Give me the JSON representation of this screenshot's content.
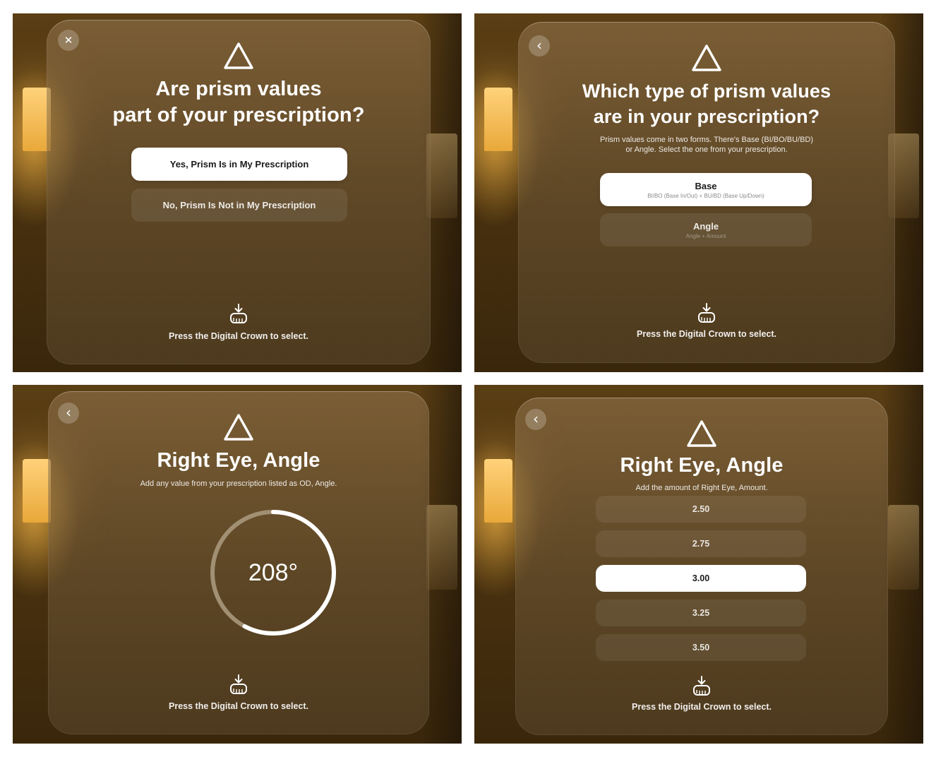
{
  "colors": {
    "glass": "#8a6e45",
    "selected_bg": "#ffffff",
    "selected_text": "#1a1a1a",
    "text": "#ffffff",
    "dial_progress": "#ffffff",
    "dial_track": "#a8987c"
  },
  "icons": {
    "close": "close-icon",
    "back": "chevron-left-icon",
    "warning": "warning-triangle-icon",
    "crown": "digital-crown-icon"
  },
  "screens": [
    {
      "corner_glyph": "✕",
      "title": [
        "Are prism values",
        "part of your prescription?"
      ],
      "options": [
        {
          "label": "Yes, Prism Is in My Prescription",
          "selected": true
        },
        {
          "label": "No, Prism Is Not in My Prescription",
          "selected": false
        }
      ],
      "hint": "Press the Digital Crown to select."
    },
    {
      "corner_glyph": "‹",
      "title": [
        "Which type of prism values",
        "are in your prescription?"
      ],
      "subtitle": [
        "Prism values come in two forms. There's Base (BI/BO/BU/BD)",
        "or Angle. Select the one from your prescription."
      ],
      "options": [
        {
          "label": "Base",
          "sub": "BI/BO (Base In/Out) + BU/BD (Base Up/Down)",
          "selected": true
        },
        {
          "label": "Angle",
          "sub": "Angle + Amount",
          "selected": false
        }
      ],
      "hint": "Press the Digital Crown to select."
    },
    {
      "corner_glyph": "‹",
      "title": [
        "Right Eye, Angle"
      ],
      "subtitle": [
        "Add any value from your prescription listed as OD, Angle."
      ],
      "dial": {
        "value": 208,
        "display": "208°",
        "max": 360
      },
      "hint": "Press the Digital Crown to select."
    },
    {
      "corner_glyph": "‹",
      "title": [
        "Right Eye, Angle"
      ],
      "subtitle": [
        "Add the amount of Right Eye, Amount."
      ],
      "amounts": [
        {
          "value": "2.50",
          "selected": false
        },
        {
          "value": "2.75",
          "selected": false
        },
        {
          "value": "3.00",
          "selected": true
        },
        {
          "value": "3.25",
          "selected": false
        },
        {
          "value": "3.50",
          "selected": false
        }
      ],
      "hint": "Press the Digital Crown to select."
    }
  ]
}
